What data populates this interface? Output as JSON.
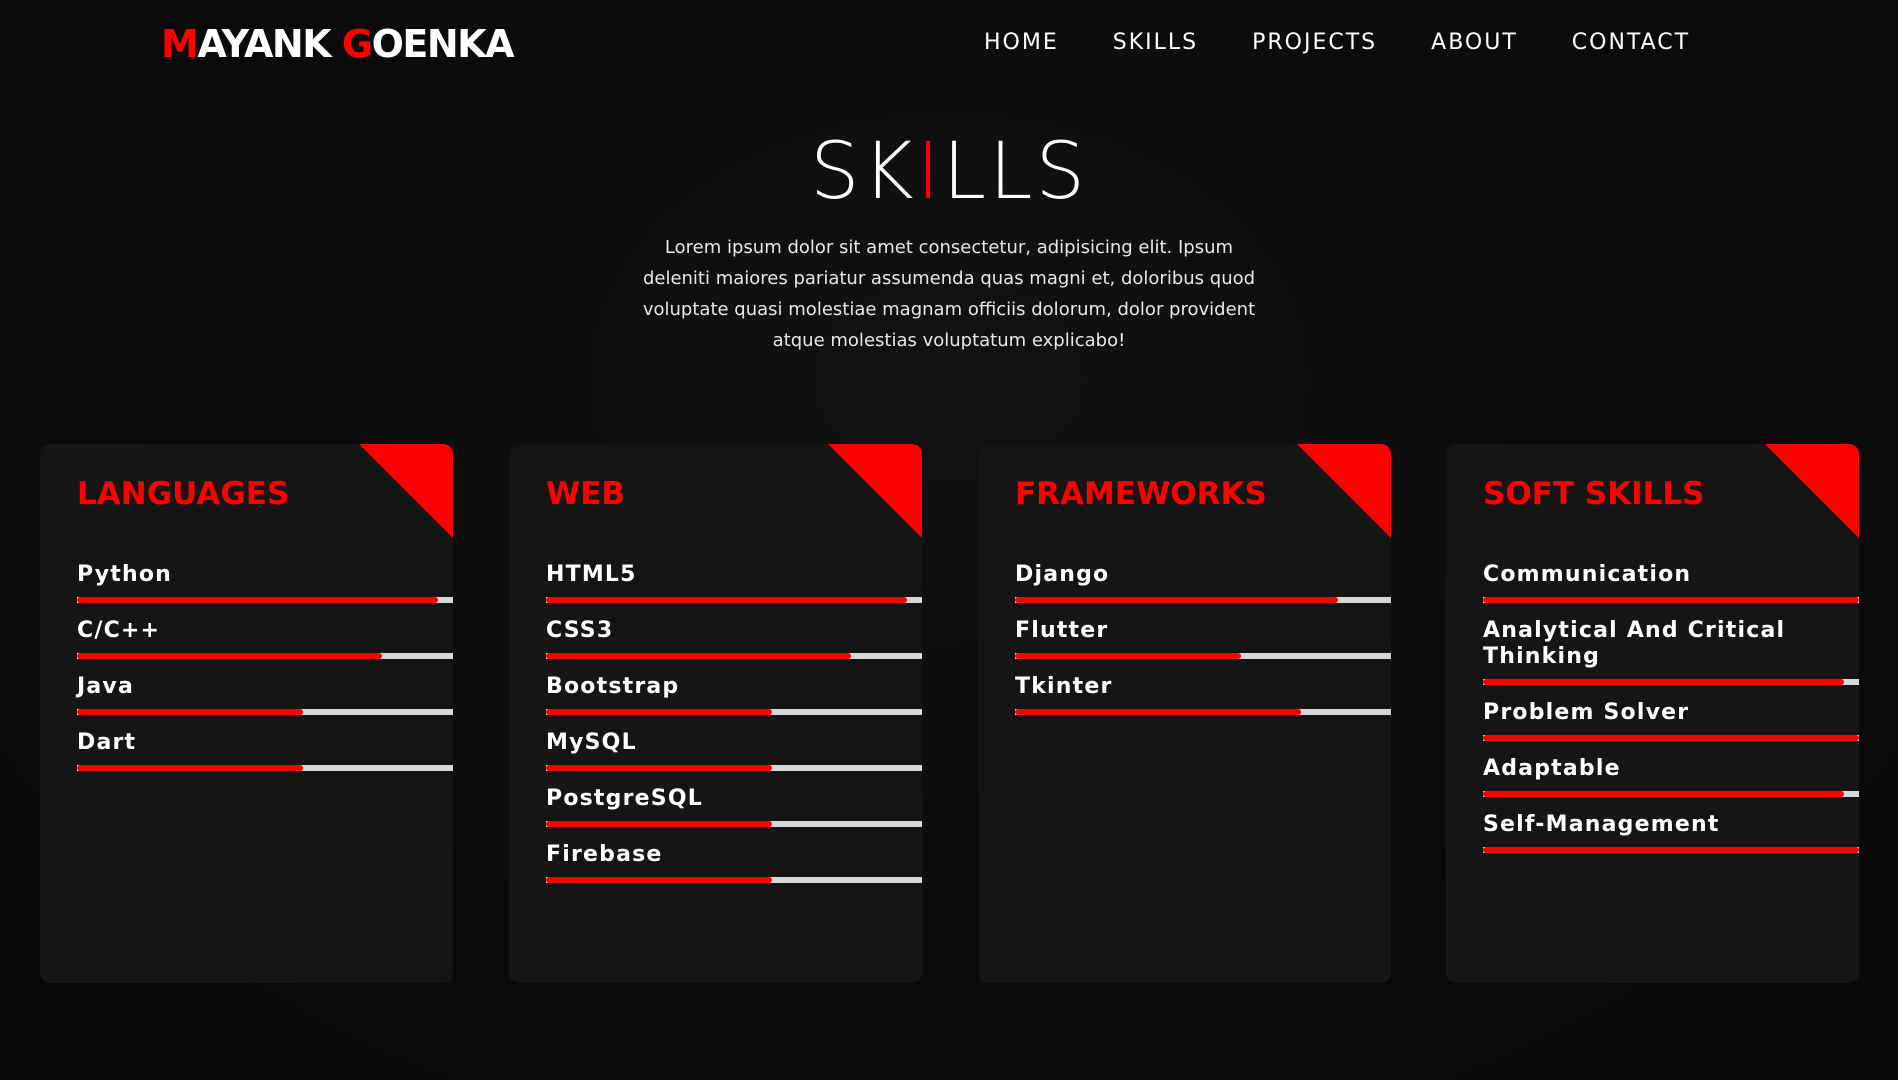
{
  "logo": {
    "first_initial": "M",
    "first_rest": "AYANK ",
    "last_initial": "G",
    "last_rest": "OENKA"
  },
  "nav": {
    "items": [
      {
        "label": "HOME"
      },
      {
        "label": "SKILLS"
      },
      {
        "label": "PROJECTS"
      },
      {
        "label": "ABOUT"
      },
      {
        "label": "CONTACT"
      }
    ]
  },
  "header": {
    "title_left": "SK",
    "title_bar": "I",
    "title_right": "LLS",
    "intro": "Lorem ipsum dolor sit amet consectetur, adipisicing elit. Ipsum deleniti maiores pariatur assumenda quas magni et, doloribus quod voluptate quasi molestiae magnam officiis dolorum, dolor provident atque molestias voluptatum explicabo!"
  },
  "colors": {
    "accent": "#ff0000",
    "card_bg": "#151515",
    "track": "#d8d8d8"
  },
  "cards": [
    {
      "title": "LANGUAGES",
      "skills": [
        {
          "name": "Python",
          "level": 0.96
        },
        {
          "name": "C/C++",
          "level": 0.81
        },
        {
          "name": "Java",
          "level": 0.6
        },
        {
          "name": "Dart",
          "level": 0.6
        }
      ]
    },
    {
      "title": "WEB",
      "skills": [
        {
          "name": "HTML5",
          "level": 0.96
        },
        {
          "name": "CSS3",
          "level": 0.81
        },
        {
          "name": "Bootstrap",
          "level": 0.6
        },
        {
          "name": "MySQL",
          "level": 0.6
        },
        {
          "name": "PostgreSQL",
          "level": 0.6
        },
        {
          "name": "Firebase",
          "level": 0.6
        }
      ]
    },
    {
      "title": "FRAMEWORKS",
      "skills": [
        {
          "name": "Django",
          "level": 0.86
        },
        {
          "name": "Flutter",
          "level": 0.6
        },
        {
          "name": "Tkinter",
          "level": 0.76
        }
      ]
    },
    {
      "title": "SOFT SKILLS",
      "skills": [
        {
          "name": "Communication",
          "level": 1.0
        },
        {
          "name": "Analytical And Critical Thinking",
          "level": 0.96
        },
        {
          "name": "Problem Solver",
          "level": 1.0
        },
        {
          "name": "Adaptable",
          "level": 0.96
        },
        {
          "name": "Self-Management",
          "level": 1.0
        }
      ]
    }
  ]
}
